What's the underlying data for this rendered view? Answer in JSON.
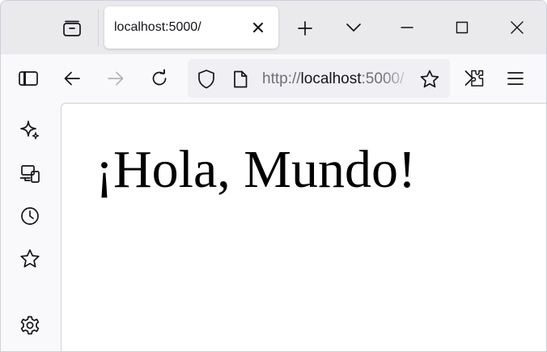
{
  "tabstrip": {
    "tab_manager_icon": "tab-manager-icon",
    "tabs": [
      {
        "title": "localhost:5000/",
        "close_icon": "close-icon"
      }
    ],
    "new_tab_icon": "plus-icon",
    "list_all_tabs_icon": "chevron-down-icon",
    "window_controls": [
      "minimize-icon",
      "maximize-icon",
      "close-icon"
    ]
  },
  "navbar": {
    "sidebar_toggle_icon": "sidebar-icon",
    "back_icon": "arrow-left-icon",
    "forward_icon": "arrow-right-icon",
    "forward_enabled": false,
    "reload_icon": "reload-icon",
    "url": {
      "protocol": "http://",
      "host": "localhost",
      "rest": ":5000/"
    },
    "tracking_protection_icon": "shield-icon",
    "page_info_icon": "page-icon",
    "bookmark_icon": "star-icon",
    "extensions_icon": "extensions-icon",
    "menu_icon": "hamburger-menu-icon"
  },
  "sidebar": {
    "items": [
      {
        "icon": "ai-sparkle-icon"
      },
      {
        "icon": "synced-devices-icon"
      },
      {
        "icon": "history-clock-icon"
      },
      {
        "icon": "bookmarks-star-icon"
      }
    ],
    "settings_icon": "gear-icon"
  },
  "page": {
    "heading": "¡Hola, Mundo!"
  },
  "colors": {
    "tabstrip_bg": "#eaeaed",
    "toolbar_bg": "#f9f9fb",
    "urlbar_bg": "#f0f0f4",
    "content_bg": "#ffffff",
    "text": "#15141a",
    "disabled_icon": "#b3b3ba"
  }
}
